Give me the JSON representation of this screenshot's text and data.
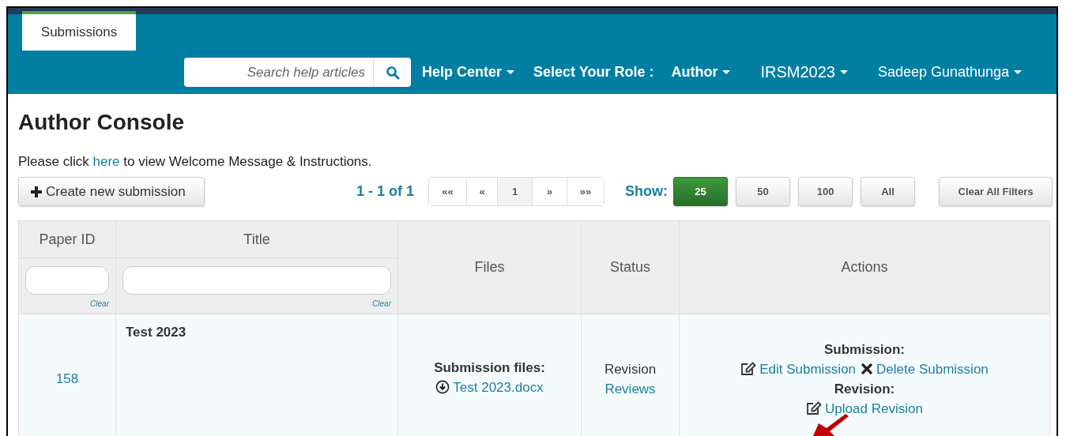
{
  "nav": {
    "tab": {
      "label": "Submissions",
      "selected": true
    },
    "search": {
      "placeholder": "Search help articles"
    },
    "menus": [
      {
        "label": "Help Center",
        "kind": "dropdown",
        "bold": true
      },
      {
        "label": "Select Your Role :",
        "kind": "label",
        "bold": true
      },
      {
        "label": "Author",
        "kind": "dropdown",
        "bold": true
      },
      {
        "label": "IRSM2023",
        "kind": "dropdown",
        "bold": false
      },
      {
        "label": "Sadeep Gunathunga",
        "kind": "dropdown",
        "bold": false
      }
    ]
  },
  "page": {
    "title": "Author Console",
    "intro": {
      "before": "Please click",
      "link": "here",
      "after": "to view Welcome Message & Instructions."
    }
  },
  "toolbar": {
    "create": "Create new submission",
    "range": "1 - 1 of 1",
    "pager": [
      {
        "label": "««",
        "selected": false
      },
      {
        "label": "«",
        "selected": false
      },
      {
        "label": "1",
        "selected": true
      },
      {
        "label": "»",
        "selected": false
      },
      {
        "label": "»»",
        "selected": false
      }
    ],
    "show_label": "Show:",
    "show": [
      {
        "label": "25",
        "selected": true
      },
      {
        "label": "50",
        "selected": false
      },
      {
        "label": "100",
        "selected": false
      },
      {
        "label": "All",
        "selected": false
      }
    ],
    "clear_filters": "Clear All Filters"
  },
  "table": {
    "columns": [
      {
        "label": "Paper ID",
        "filter": {
          "clear": "Clear"
        }
      },
      {
        "label": "Title",
        "filter": {
          "clear": "Clear"
        }
      },
      {
        "label": "Files"
      },
      {
        "label": "Status"
      },
      {
        "label": "Actions"
      }
    ],
    "rows": [
      {
        "paper_id": "158",
        "title": "Test 2023",
        "files_heading": "Submission files:",
        "file": "Test 2023.docx",
        "status": "Revision",
        "status_link": "Reviews",
        "actions": [
          {
            "heading": "Submission:",
            "links": [
              {
                "label": "Edit Submission",
                "kind": "edit"
              },
              {
                "label": "Delete Submission",
                "kind": "delete"
              }
            ]
          },
          {
            "heading": "Revision:",
            "links": [
              {
                "label": "Upload Revision",
                "kind": "edit"
              }
            ]
          }
        ]
      }
    ]
  }
}
